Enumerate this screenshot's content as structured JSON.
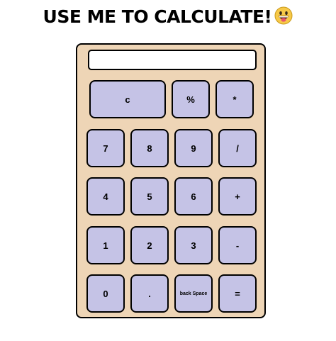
{
  "title": "USE ME TO CALCULATE!",
  "title_emoji": "grinning-tongue-face-emoji",
  "display": {
    "value": ""
  },
  "colors": {
    "body": "#eed5b6",
    "key": "#c5c3e6",
    "border": "#000000",
    "display": "#ffffff"
  },
  "keys": {
    "clear": "c",
    "percent": "%",
    "multiply": "*",
    "seven": "7",
    "eight": "8",
    "nine": "9",
    "divide": "/",
    "four": "4",
    "five": "5",
    "six": "6",
    "plus": "+",
    "one": "1",
    "two": "2",
    "three": "3",
    "minus": "-",
    "zero": "0",
    "dot": ".",
    "backspace": "back Space",
    "equals": "="
  }
}
